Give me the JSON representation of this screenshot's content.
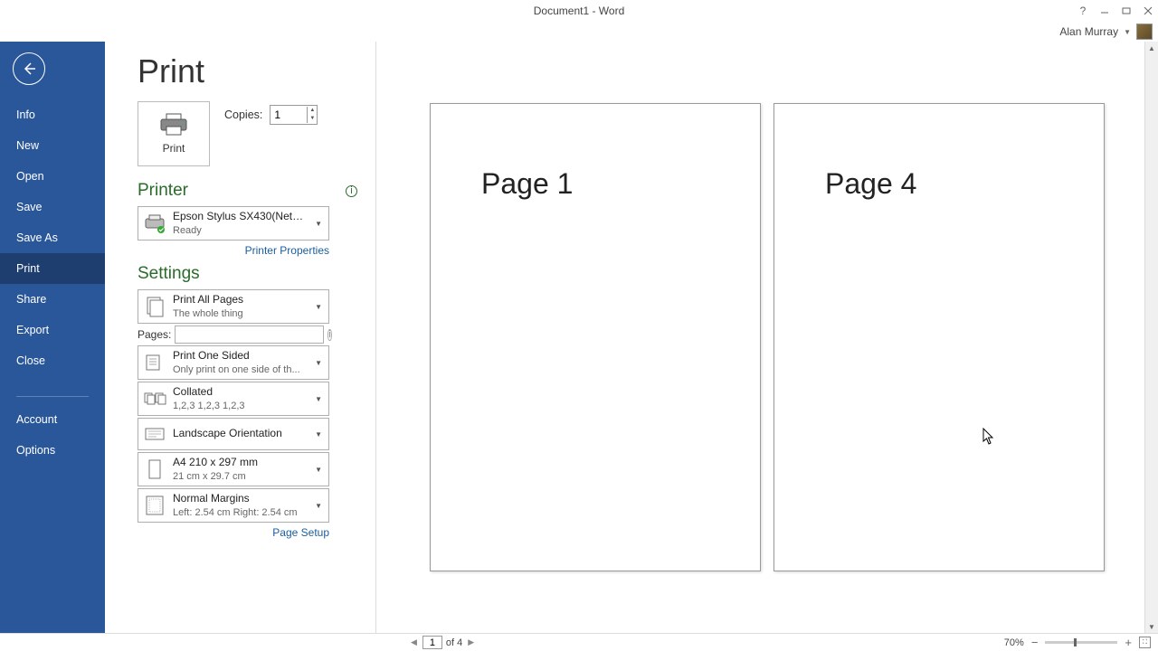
{
  "window": {
    "title": "Document1 - Word"
  },
  "user": {
    "name": "Alan Murray"
  },
  "sidebar": {
    "items": [
      "Info",
      "New",
      "Open",
      "Save",
      "Save As",
      "Print",
      "Share",
      "Export",
      "Close"
    ],
    "bottom": [
      "Account",
      "Options"
    ],
    "active": "Print"
  },
  "page": {
    "title": "Print"
  },
  "print_button": {
    "label": "Print"
  },
  "copies": {
    "label": "Copies:",
    "value": "1"
  },
  "printer": {
    "heading": "Printer",
    "name": "Epson Stylus SX430(Network)",
    "status": "Ready",
    "properties_link": "Printer Properties"
  },
  "settings": {
    "heading": "Settings",
    "pages_label": "Pages:",
    "pages_value": "",
    "items": [
      {
        "t1": "Print All Pages",
        "t2": "The whole thing",
        "icon": "pages"
      },
      {
        "t1": "Print One Sided",
        "t2": "Only print on one side of th...",
        "icon": "oneside"
      },
      {
        "t1": "Collated",
        "t2": "1,2,3    1,2,3    1,2,3",
        "icon": "collate"
      },
      {
        "t1": "Landscape Orientation",
        "t2": "",
        "icon": "landscape"
      },
      {
        "t1": "A4 210 x 297 mm",
        "t2": "21 cm x 29.7 cm",
        "icon": "paper"
      },
      {
        "t1": "Normal Margins",
        "t2": "Left:  2.54 cm    Right:  2.54 cm",
        "icon": "margins"
      }
    ],
    "page_setup_link": "Page Setup"
  },
  "preview": {
    "page1_text": "Page 1",
    "page2_text": "Page 4"
  },
  "footer": {
    "current_page": "1",
    "of_label": "of 4",
    "zoom": "70%"
  }
}
